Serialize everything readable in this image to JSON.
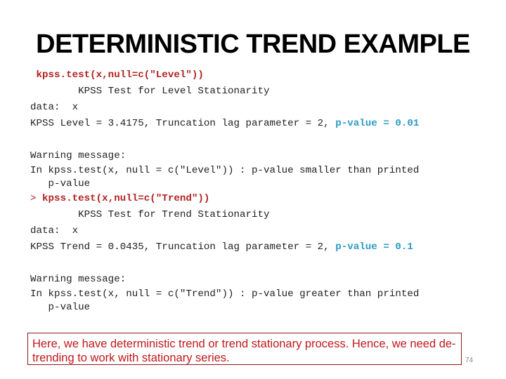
{
  "slide": {
    "title": "DETERMINISTIC TREND EXAMPLE",
    "page_number": "74"
  },
  "console": {
    "level": {
      "command": " kpss.test(x,null=c(\"Level\"))",
      "test_name": "        KPSS Test for Level Stationarity",
      "data_line": "data:  x",
      "result_prefix": "KPSS Level = 3.4175, Truncation lag parameter = 2, ",
      "p_value": "p-value = 0.01",
      "warning_header": "Warning message:",
      "warning_text": "In kpss.test(x, null = c(\"Level\")) : p-value smaller than printed",
      "warning_cont": "   p-value"
    },
    "trend": {
      "prompt": "> ",
      "command": "kpss.test(x,null=c(\"Trend\"))",
      "test_name": "        KPSS Test for Trend Stationarity",
      "data_line": "data:  x",
      "result_prefix": "KPSS Trend = 0.0435, Truncation lag parameter = 2, ",
      "p_value": "p-value = 0.1",
      "warning_header": "Warning message:",
      "warning_text": "In kpss.test(x, null = c(\"Trend\")) : p-value greater than printed",
      "warning_cont": "   p-value"
    }
  },
  "note": {
    "text": "Here, we have deterministic trend or trend stationary process. Hence, we need de-trending to work with stationary series."
  },
  "colors": {
    "command": "#b22222",
    "p_value": "#2b9bc4",
    "note_text": "#c0171c"
  }
}
